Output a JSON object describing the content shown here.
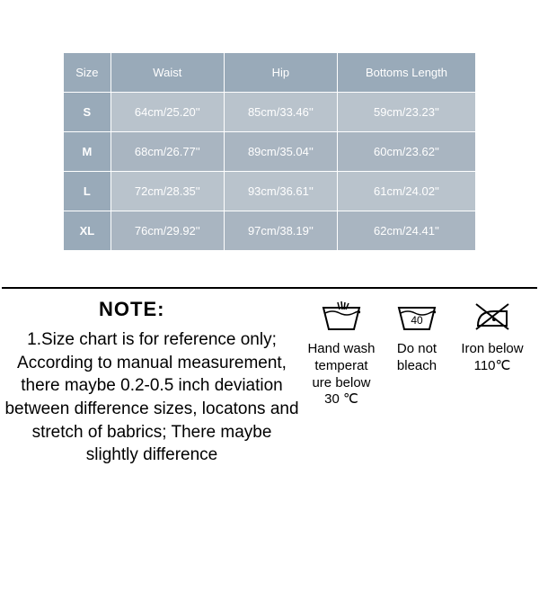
{
  "table": {
    "headers": [
      "Size",
      "Waist",
      "Hip",
      "Bottoms Length"
    ],
    "rows": [
      {
        "size": "S",
        "waist": "64cm/25.20''",
        "hip": "85cm/33.46''",
        "length": "59cm/23.23''"
      },
      {
        "size": "M",
        "waist": "68cm/26.77''",
        "hip": "89cm/35.04''",
        "length": "60cm/23.62''"
      },
      {
        "size": "L",
        "waist": "72cm/28.35''",
        "hip": "93cm/36.61''",
        "length": "61cm/24.02''"
      },
      {
        "size": "XL",
        "waist": "76cm/29.92''",
        "hip": "97cm/38.19''",
        "length": "62cm/24.41''"
      }
    ]
  },
  "note": {
    "title": "NOTE:",
    "body": "1.Size chart is for reference only; According to manual measurement, there maybe 0.2-0.5 inch deviation between difference sizes, locatons and stretch of babrics; There maybe slightly difference"
  },
  "care": [
    {
      "icon": "hand-wash-icon",
      "label": "Hand wash temperat ure below 30 ℃"
    },
    {
      "icon": "wash-40-icon",
      "label": "Do not bleach",
      "inner_text": "40"
    },
    {
      "icon": "no-iron-icon",
      "label": "Iron below 110℃"
    }
  ]
}
